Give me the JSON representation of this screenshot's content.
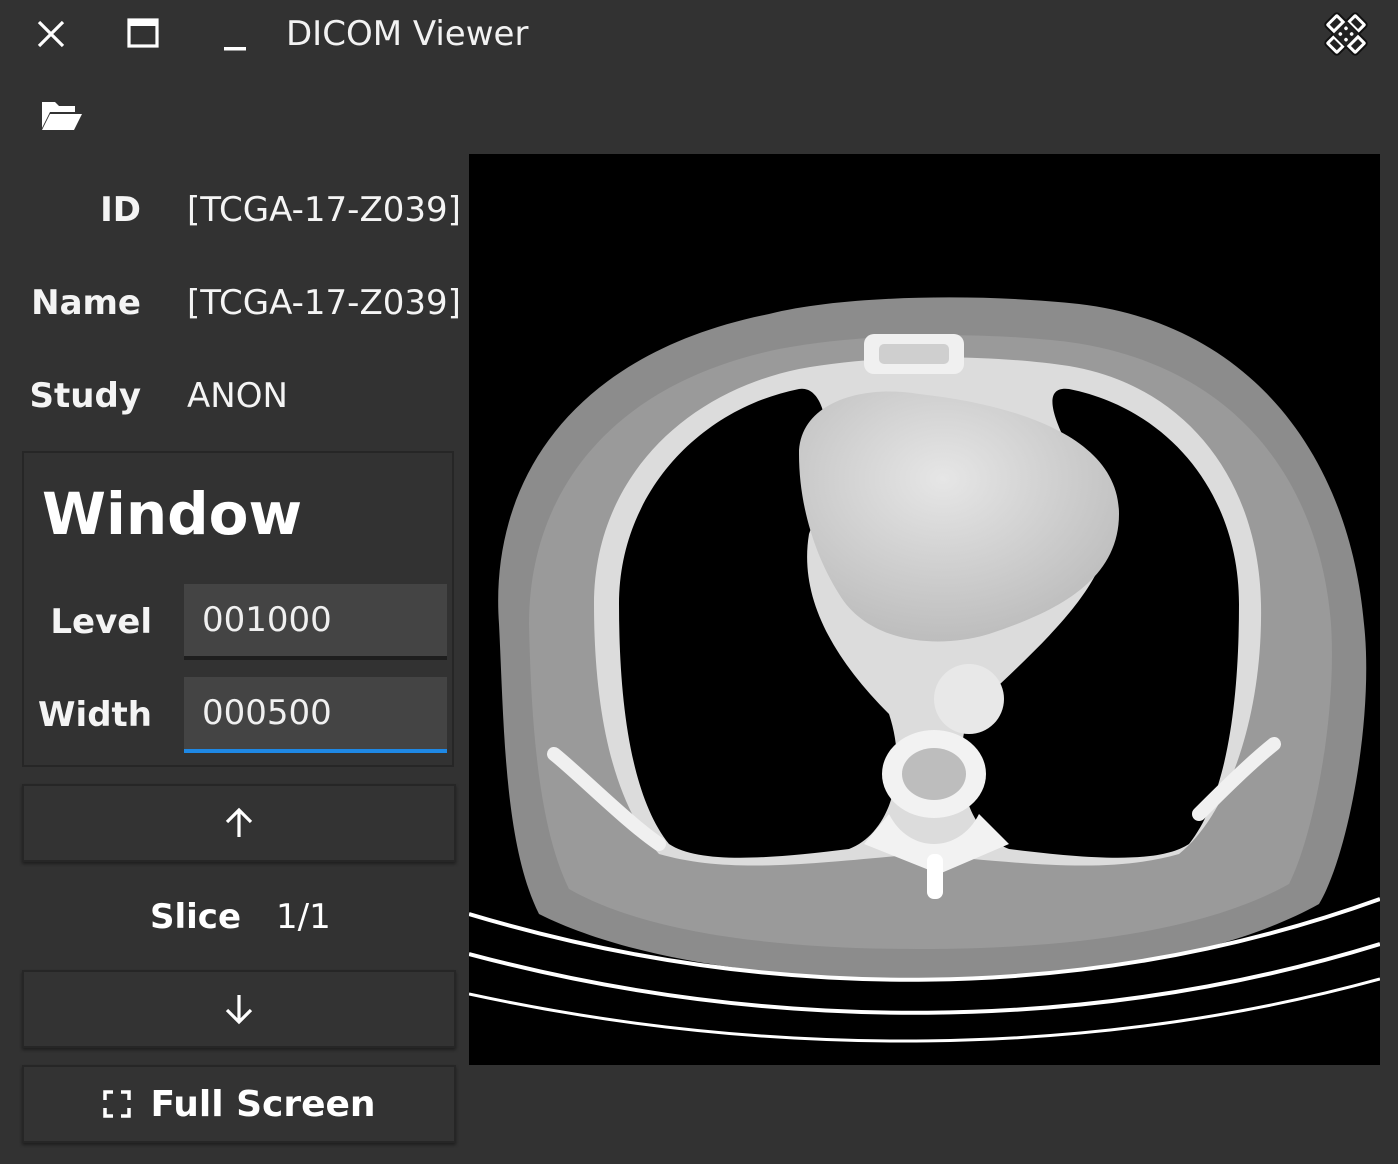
{
  "window": {
    "title": "DICOM Viewer",
    "controls": {
      "close": "close-icon",
      "maximize": "maximize-icon",
      "minimize": "minimize-icon"
    },
    "logo_icon": "app-logo-icon"
  },
  "toolbar": {
    "open_icon": "folder-open-icon"
  },
  "patient": {
    "id_label": "ID",
    "id_value": "[TCGA-17-Z039]",
    "name_label": "Name",
    "name_value": "[TCGA-17-Z039]",
    "study_label": "Study",
    "study_value": "ANON"
  },
  "window_panel": {
    "title": "Window",
    "level_label": "Level",
    "level_value": "001000",
    "width_label": "Width",
    "width_value": "000500"
  },
  "slice": {
    "up_icon": "arrow-up-icon",
    "label": "Slice",
    "value": "1/1",
    "down_icon": "arrow-down-icon"
  },
  "fullscreen": {
    "icon": "fullscreen-icon",
    "label": "Full Screen"
  },
  "colors": {
    "background": "#323232",
    "field": "#444444",
    "focus_accent": "#1e88e5",
    "viewer_bg": "#000000"
  }
}
